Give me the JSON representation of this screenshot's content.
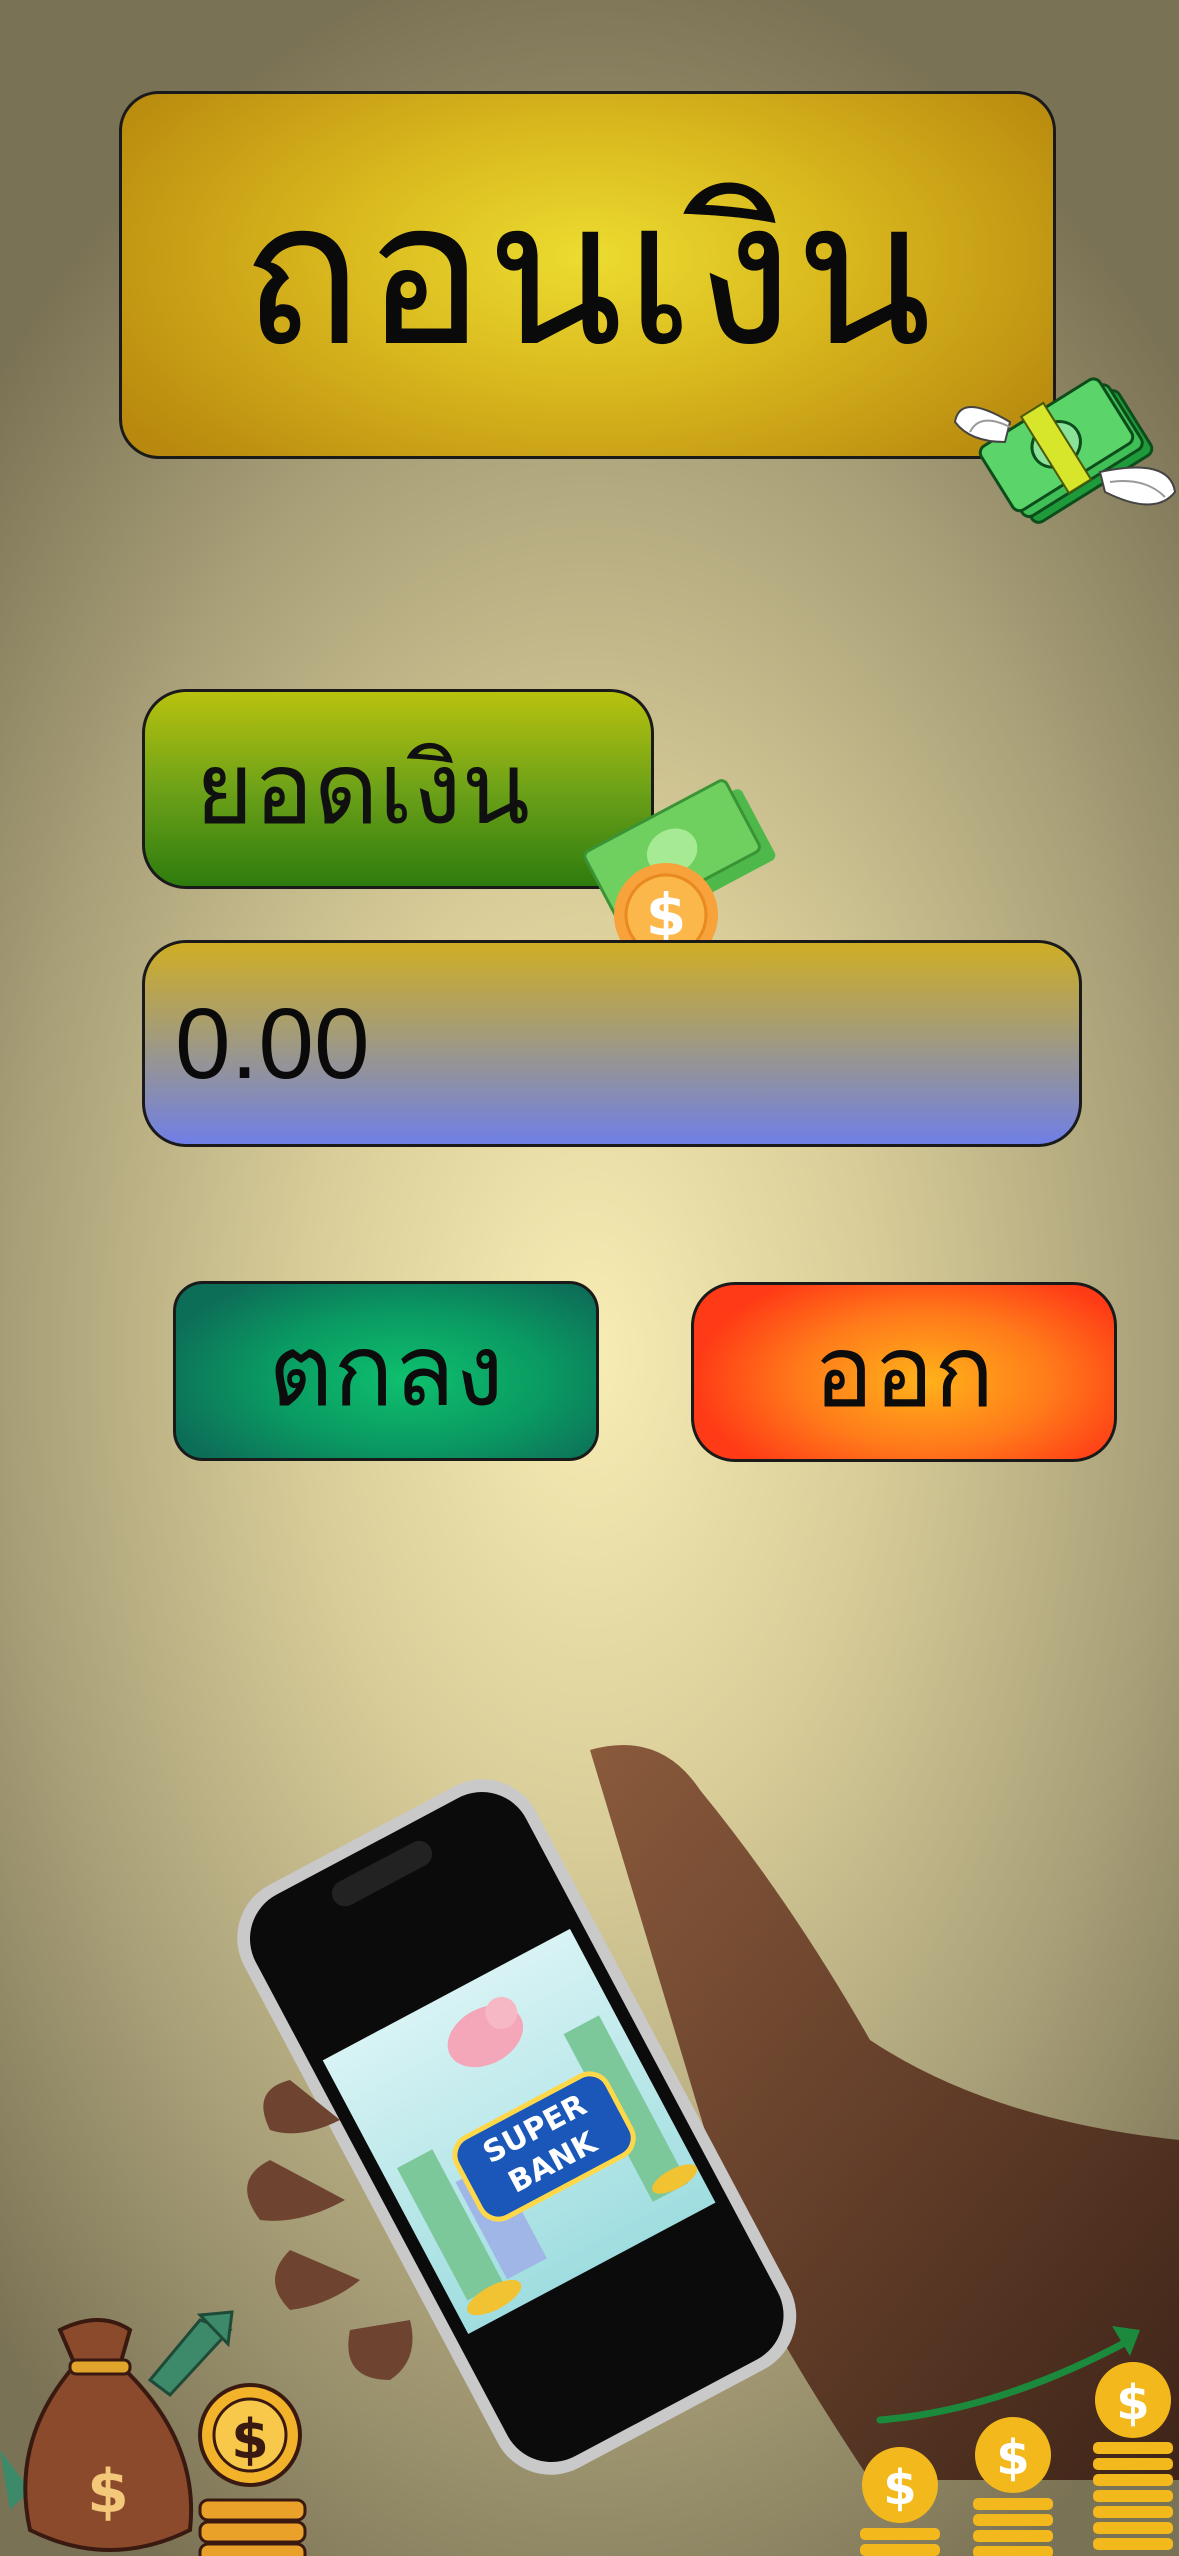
{
  "title": "ถอนเงิน",
  "amount": {
    "label": "ยอดเงิน",
    "value": "0.00"
  },
  "buttons": {
    "confirm_label": "ตกลง",
    "exit_label": "ออก"
  },
  "phone_screen": {
    "brand_line1": "SUPER",
    "brand_line2": "BANK"
  },
  "icons": {
    "winged_money": "winged-money-icon",
    "cash_coin": "cash-coin-icon",
    "money_bag": "money-bag-icon",
    "coin_growth": "coin-growth-icon"
  },
  "colors": {
    "title_gold": "#e2c824",
    "label_green": "#6ea218",
    "field_blue": "#6f7fe6",
    "ok_green": "#0ec06e",
    "exit_orange": "#ff6a1a"
  }
}
